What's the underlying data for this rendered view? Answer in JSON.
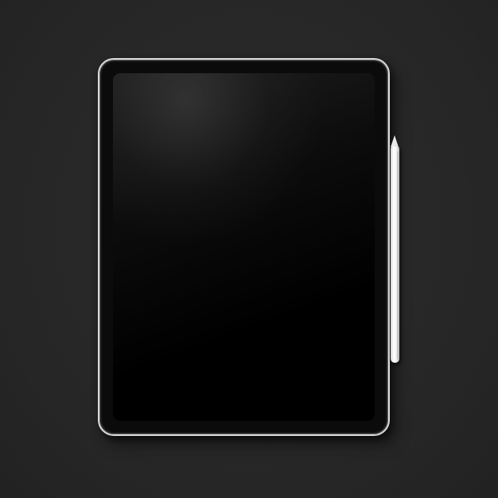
{
  "scene": {
    "background_color": "#282828",
    "tablet": {
      "frame_color": "#d9d9d9",
      "screen_color": "#000000",
      "screen_content": ""
    },
    "stylus": {
      "color": "#f2f2f2"
    }
  }
}
